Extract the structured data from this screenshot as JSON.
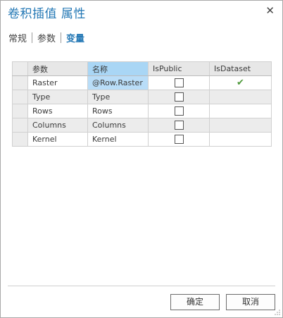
{
  "dialog": {
    "title": "卷积插值 属性",
    "close_glyph": "✕"
  },
  "tabs": [
    {
      "label": "常规",
      "active": false
    },
    {
      "label": "参数",
      "active": false
    },
    {
      "label": "变量",
      "active": true
    }
  ],
  "grid": {
    "columns": [
      "参数",
      "名称",
      "IsPublic",
      "IsDataset"
    ],
    "selected_column": "名称",
    "rows": [
      {
        "param": "Raster",
        "name": "@Row.Raster",
        "is_public": false,
        "is_dataset": true,
        "is_dataset_glyph": "✔"
      },
      {
        "param": "Type",
        "name": "Type",
        "is_public": false,
        "is_dataset": false
      },
      {
        "param": "Rows",
        "name": "Rows",
        "is_public": false,
        "is_dataset": false
      },
      {
        "param": "Columns",
        "name": "Columns",
        "is_public": false,
        "is_dataset": false
      },
      {
        "param": "Kernel",
        "name": "Kernel",
        "is_public": false,
        "is_dataset": false
      }
    ]
  },
  "buttons": {
    "ok_label": "确定",
    "cancel_label": "取消"
  },
  "colors": {
    "accent": "#2478b5",
    "selected_header": "#a9d6f5",
    "check": "#4f9a3c"
  }
}
